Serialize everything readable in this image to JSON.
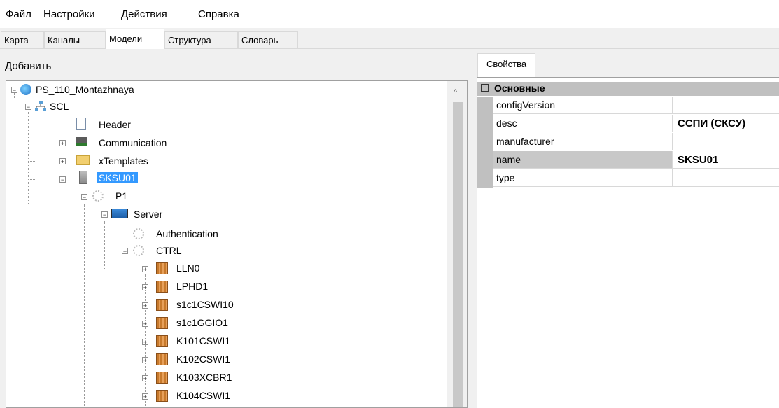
{
  "menu": [
    "Файл",
    "Настройки",
    "Действия",
    "Справка"
  ],
  "tabs": [
    "Карта",
    "Каналы",
    "Модели",
    "Структура",
    "Словарь"
  ],
  "active_tab": "Модели",
  "left": {
    "add_label": "Добавить"
  },
  "tree": {
    "root": "PS_110_Montazhnaya",
    "scl": "SCL",
    "header": "Header",
    "communication": "Communication",
    "xtemplates": "xTemplates",
    "ied": "SKSU01",
    "p1": "P1",
    "server": "Server",
    "auth": "Authentication",
    "ctrl": "CTRL",
    "lns": [
      "LLN0",
      "LPHD1",
      "s1c1CSWI10",
      "s1c1GGIO1",
      "K101CSWI1",
      "K102CSWI1",
      "K103XCBR1",
      "K104CSWI1"
    ]
  },
  "properties": {
    "tab_label": "Свойства",
    "category": "Основные",
    "rows": [
      {
        "name": "configVersion",
        "value": ""
      },
      {
        "name": "desc",
        "value": "ССПИ (СКСУ)"
      },
      {
        "name": "manufacturer",
        "value": ""
      },
      {
        "name": "name",
        "value": "SKSU01"
      },
      {
        "name": "type",
        "value": ""
      }
    ],
    "selected_row": "name"
  },
  "colors": {
    "selection": "#3399ff",
    "category_bg": "#c0c0c0"
  }
}
